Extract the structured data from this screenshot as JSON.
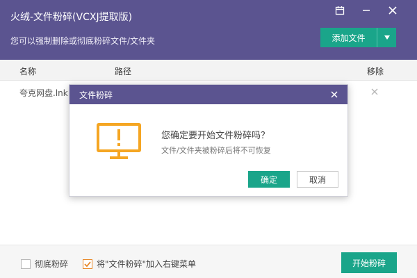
{
  "window": {
    "title": "火绒-文件粉碎(VCXJ提取版)",
    "subtitle": "您可以强制删除或彻底粉碎文件/文件夹",
    "controls": [
      "calendar-icon",
      "minimize-icon",
      "close-icon"
    ]
  },
  "toolbar": {
    "add_label": "添加文件",
    "dropdown_icon": "caret-down-icon"
  },
  "table": {
    "headers": {
      "name": "名称",
      "path": "路径",
      "remove": "移除"
    },
    "rows": [
      {
        "name": "夸克网盘.lnk",
        "path": "",
        "remove_icon": "close-icon"
      }
    ]
  },
  "footer": {
    "shred_thoroughly": {
      "label": "彻底粉碎",
      "checked": false
    },
    "context_menu": {
      "label": "将\"文件粉碎\"加入右键菜单",
      "checked": true
    },
    "start_label": "开始粉碎"
  },
  "dialog": {
    "title": "文件粉碎",
    "question": "您确定要开始文件粉碎吗？",
    "hint": "文件/文件夹被粉碎后将不可恢复",
    "ok_label": "确定",
    "cancel_label": "取消",
    "icon": "monitor-warning-icon"
  },
  "colors": {
    "header": "#5b5490",
    "accent_green": "#1aa58a",
    "warning_orange": "#f5a623",
    "checkbox_orange": "#e8892a"
  }
}
